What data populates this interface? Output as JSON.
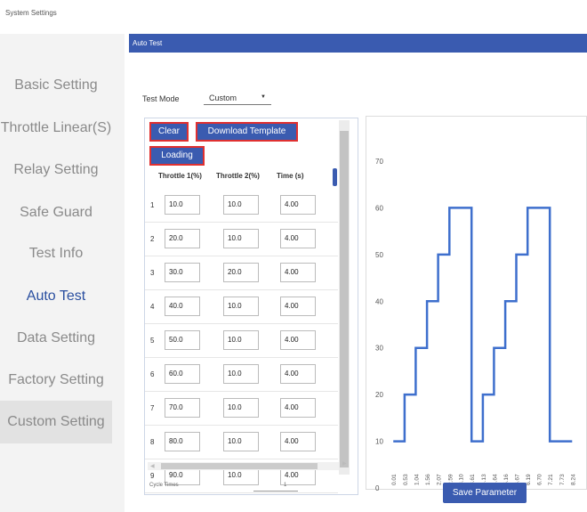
{
  "app_title": "System Settings",
  "sidebar": {
    "items": [
      {
        "label": "Basic Setting"
      },
      {
        "label": "Throttle Linear(S)"
      },
      {
        "label": "Relay Setting"
      },
      {
        "label": "Safe Guard"
      },
      {
        "label": "Test Info"
      },
      {
        "label": "Auto Test"
      },
      {
        "label": "Data Setting"
      },
      {
        "label": "Factory Setting"
      },
      {
        "label": "Custom Setting"
      }
    ],
    "active": "Auto Test",
    "highlighted": "Custom Setting",
    "active_color": "#2a4fa0"
  },
  "header": {
    "title": "Auto Test",
    "color": "#3a5bb0"
  },
  "test_mode": {
    "label": "Test Mode",
    "value": "Custom",
    "icon": "chevron-down-icon"
  },
  "toolbar": {
    "clear_label": "Clear",
    "download_label": "Download Template",
    "loading_label": "Loading"
  },
  "table": {
    "columns": [
      "Throttle 1(%)",
      "Throttle 2(%)",
      "Time (s)"
    ],
    "rows": [
      {
        "index": "1",
        "t1": "10.0",
        "t2": "10.0",
        "time": "4.00"
      },
      {
        "index": "2",
        "t1": "20.0",
        "t2": "10.0",
        "time": "4.00"
      },
      {
        "index": "3",
        "t1": "30.0",
        "t2": "20.0",
        "time": "4.00"
      },
      {
        "index": "4",
        "t1": "40.0",
        "t2": "10.0",
        "time": "4.00"
      },
      {
        "index": "5",
        "t1": "50.0",
        "t2": "10.0",
        "time": "4.00"
      },
      {
        "index": "6",
        "t1": "60.0",
        "t2": "10.0",
        "time": "4.00"
      },
      {
        "index": "7",
        "t1": "70.0",
        "t2": "10.0",
        "time": "4.00"
      },
      {
        "index": "8",
        "t1": "80.0",
        "t2": "10.0",
        "time": "4.00"
      },
      {
        "index": "9",
        "t1": "90.0",
        "t2": "10.0",
        "time": "4.00"
      }
    ],
    "footer_label": "Cycle Times",
    "footer_value": "1"
  },
  "save_button": {
    "label": "Save Parameter"
  },
  "chart_data": {
    "type": "line",
    "title": "",
    "xlabel": "",
    "ylabel": "",
    "y_ticks": [
      0,
      10,
      20,
      30,
      40,
      50,
      60,
      70
    ],
    "ylim": [
      0,
      70
    ],
    "x_tick_labels": [
      "0.01",
      "0.53",
      "1.04",
      "1.56",
      "2.07",
      "2.59",
      "3.10",
      "3.61",
      "4.13",
      "4.64",
      "5.16",
      "5.67",
      "6.19",
      "6.70",
      "7.21",
      "7.73",
      "8.24"
    ],
    "xlim": [
      0,
      8.8
    ],
    "grid": false,
    "line_color": "#3e6fcd",
    "series": [
      {
        "x": [
          0.01,
          0.53,
          0.53,
          1.04,
          1.04,
          1.56,
          1.56,
          2.07,
          2.07,
          2.59,
          2.59,
          3.1,
          3.1,
          3.61,
          3.61,
          3.61,
          4.13,
          4.13,
          4.64,
          4.64,
          5.16,
          5.16,
          5.67,
          5.67,
          6.19,
          6.19,
          6.7,
          6.7,
          7.21,
          7.21,
          7.73,
          7.73,
          8.24,
          8.24,
          8.24
        ],
        "y": [
          10,
          10,
          20,
          20,
          30,
          30,
          40,
          40,
          50,
          50,
          60,
          60,
          60,
          60,
          10,
          10,
          10,
          20,
          20,
          30,
          30,
          40,
          40,
          50,
          50,
          60,
          60,
          60,
          60,
          10,
          10,
          10,
          10,
          10,
          10
        ]
      }
    ]
  }
}
